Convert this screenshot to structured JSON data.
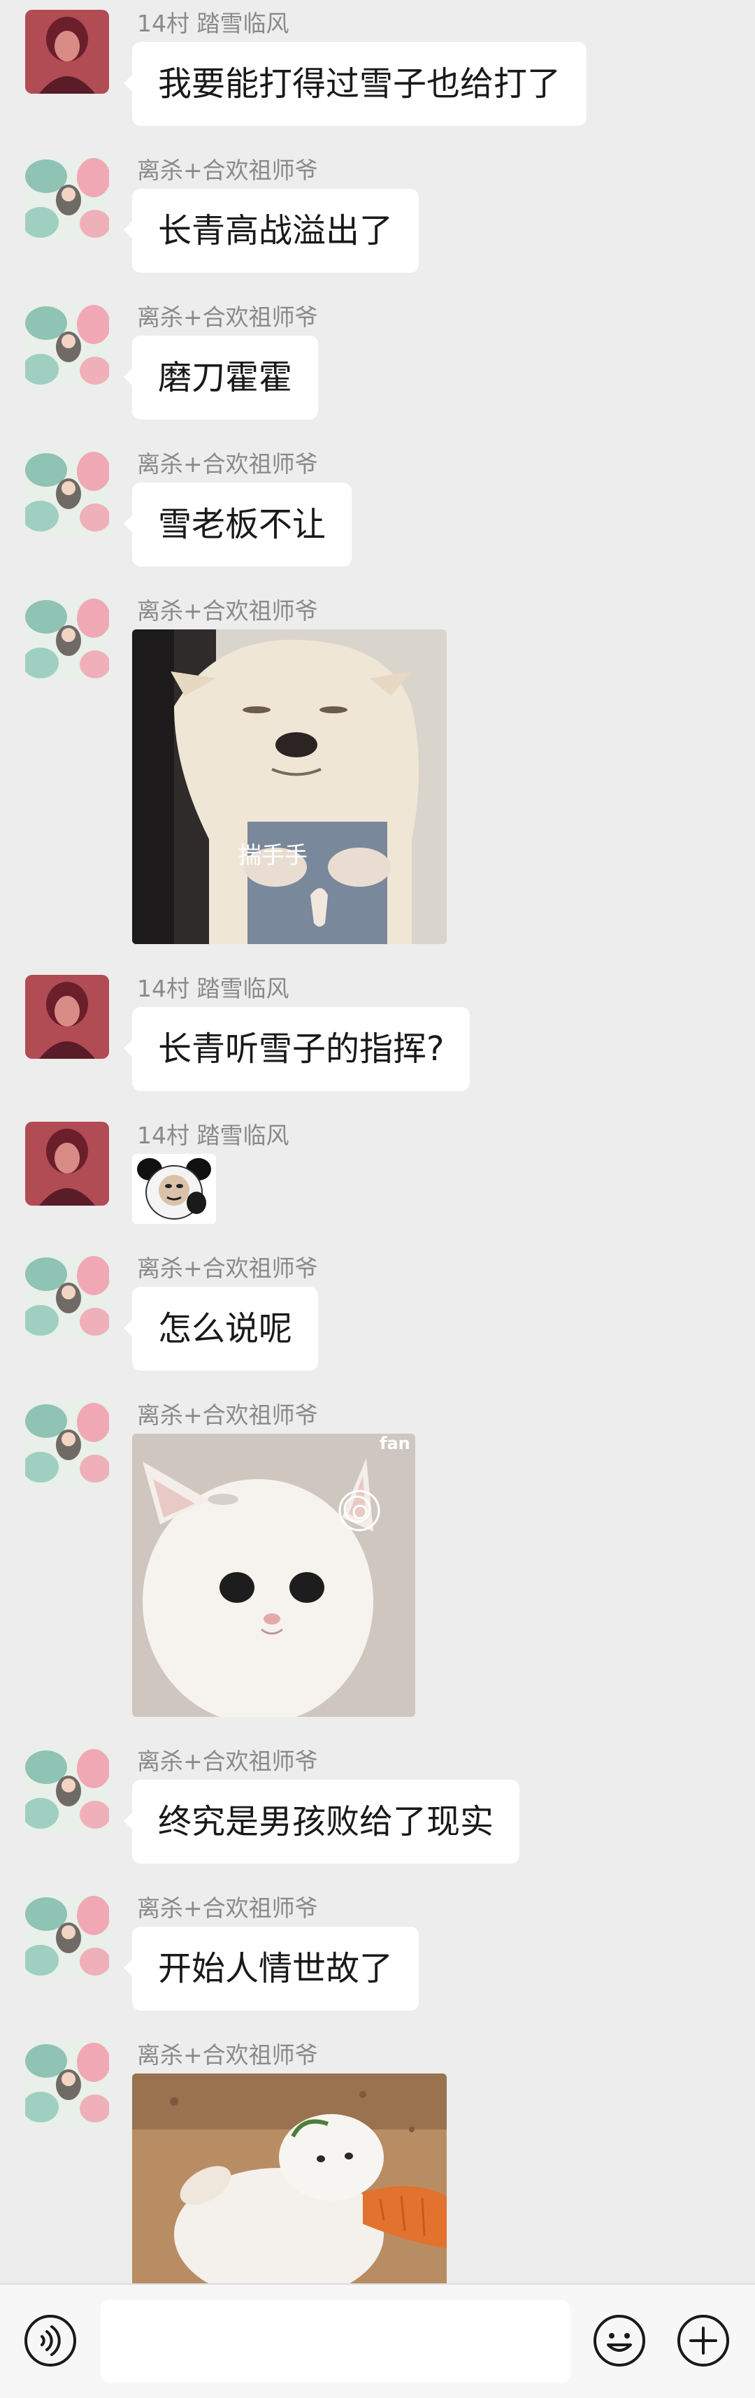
{
  "messages": [
    {
      "sender": "14村 踏雪临风",
      "type": "text",
      "text": "我要能打得过雪子也给打了"
    },
    {
      "sender": "离杀+合欢祖师爷",
      "type": "text",
      "text": "长青高战溢出了"
    },
    {
      "sender": "离杀+合欢祖师爷",
      "type": "text",
      "text": "磨刀霍霍"
    },
    {
      "sender": "离杀+合欢祖师爷",
      "type": "text",
      "text": "雪老板不让"
    },
    {
      "sender": "离杀+合欢祖师爷",
      "type": "sticker",
      "sticker": "dog-sticker",
      "caption": "揣手手"
    },
    {
      "sender": "14村 踏雪临风",
      "type": "text",
      "text": "长青听雪子的指挥?"
    },
    {
      "sender": "14村 踏雪临风",
      "type": "sticker",
      "sticker": "panda-face-sticker"
    },
    {
      "sender": "离杀+合欢祖师爷",
      "type": "text",
      "text": "怎么说呢"
    },
    {
      "sender": "离杀+合欢祖师爷",
      "type": "sticker",
      "sticker": "cat-sticker",
      "caption": "fan"
    },
    {
      "sender": "离杀+合欢祖师爷",
      "type": "text",
      "text": "终究是男孩败给了现实"
    },
    {
      "sender": "离杀+合欢祖师爷",
      "type": "text",
      "text": "开始人情世故了"
    },
    {
      "sender": "离杀+合欢祖师爷",
      "type": "sticker",
      "sticker": "rabbit-carrot-sticker"
    }
  ],
  "input_bar": {
    "value": "",
    "voice_icon": "voice-icon",
    "emoji_icon": "emoji-icon",
    "add_icon": "plus-icon"
  },
  "colors": {
    "background": "#ededed",
    "bubble": "#ffffff",
    "nickname": "#8a8a8a",
    "text": "#191919"
  }
}
